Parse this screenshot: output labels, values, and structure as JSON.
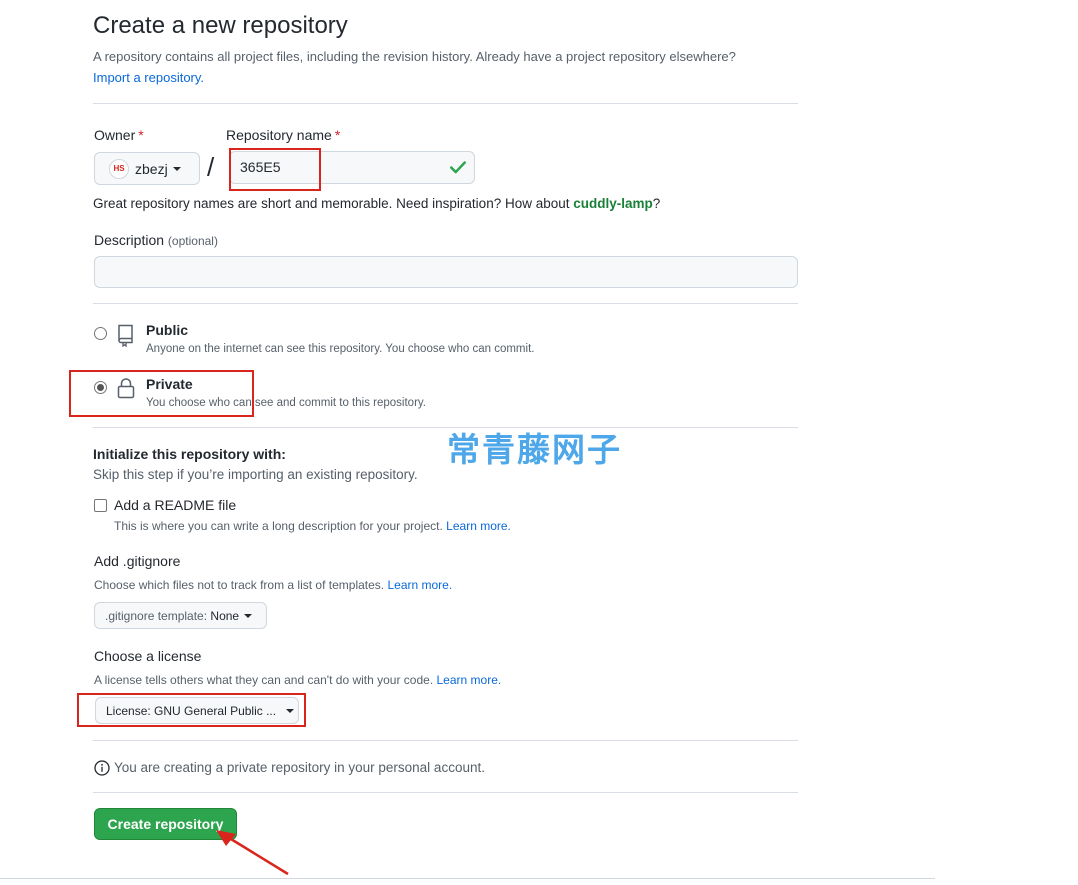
{
  "header": {
    "title": "Create a new repository",
    "subtitle": "A repository contains all project files, including the revision history. Already have a project repository elsewhere?",
    "import_link": "Import a repository."
  },
  "owner": {
    "label": "Owner",
    "required_mark": "*",
    "value": "zbezj",
    "avatar_text": "HS"
  },
  "repo_name": {
    "label": "Repository name",
    "required_mark": "*",
    "value": "365E5",
    "separator": "/"
  },
  "name_hint": {
    "text": "Great repository names are short and memorable. Need inspiration? How about ",
    "suggestion": "cuddly-lamp",
    "suffix": "?"
  },
  "description": {
    "label": "Description",
    "optional": "(optional)",
    "value": ""
  },
  "visibility": {
    "public": {
      "title": "Public",
      "desc": "Anyone on the internet can see this repository. You choose who can commit.",
      "checked": false
    },
    "private": {
      "title": "Private",
      "desc": "You choose who can see and commit to this repository.",
      "checked": true
    }
  },
  "initialize": {
    "title": "Initialize this repository with:",
    "desc": "Skip this step if you’re importing an existing repository.",
    "readme": {
      "label": "Add a README file",
      "desc": "This is where you can write a long description for your project.",
      "link": "Learn more."
    }
  },
  "gitignore": {
    "title": "Add .gitignore",
    "desc": "Choose which files not to track from a list of templates.",
    "link": "Learn more.",
    "select_label": ".gitignore template:",
    "select_value": "None"
  },
  "license": {
    "title": "Choose a license",
    "desc": "A license tells others what they can and can't do with your code.",
    "link": "Learn more.",
    "select_label": "License:",
    "select_value": "GNU General Public ..."
  },
  "notice": {
    "text": "You are creating a private repository in your personal account."
  },
  "actions": {
    "create_label": "Create repository"
  },
  "watermark": {
    "text": "常青藤网子"
  },
  "colors": {
    "accent_green": "#2da44e",
    "link_blue": "#0969da",
    "annotation_red": "#d9261c",
    "watermark_blue": "#3ea0e8"
  }
}
